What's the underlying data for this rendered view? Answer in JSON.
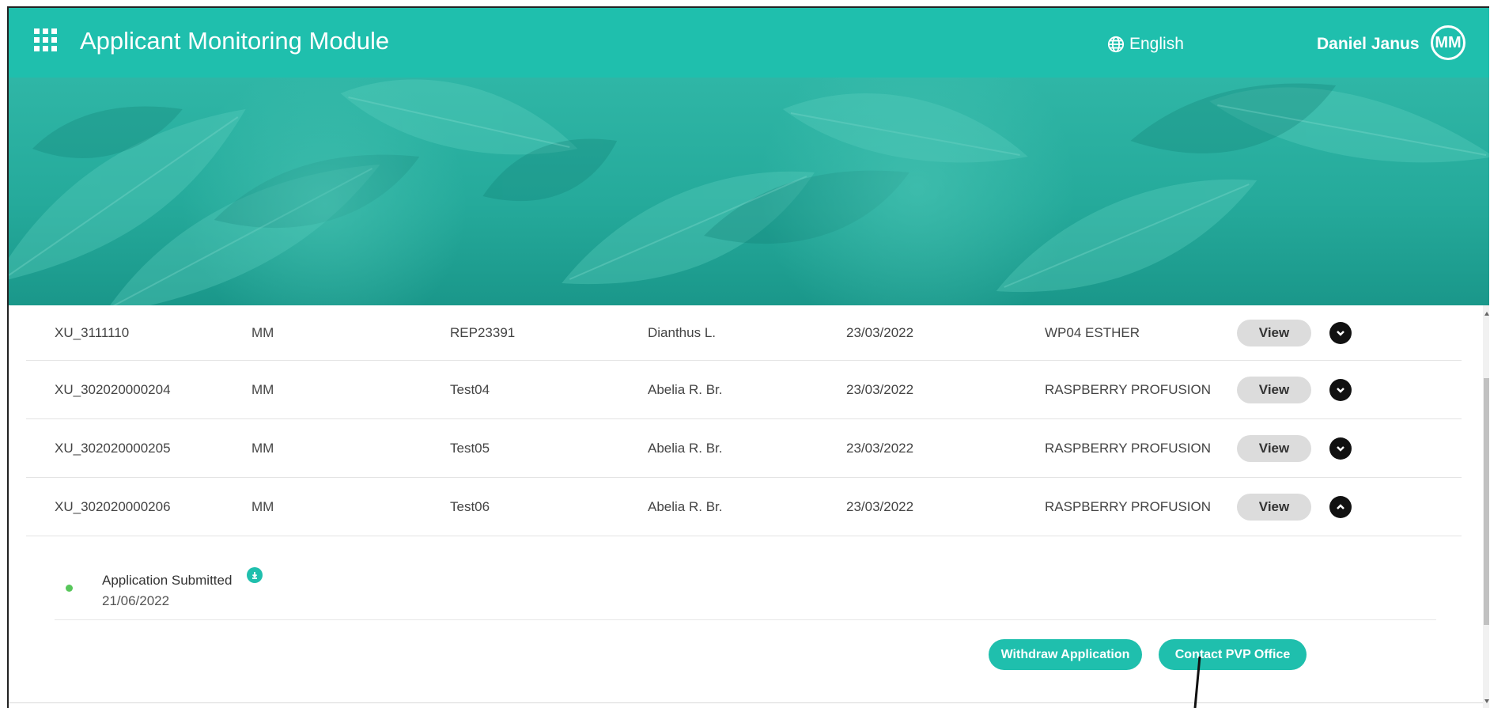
{
  "header": {
    "title": "Applicant Monitoring Module",
    "language": "English",
    "user_name": "Daniel Janus",
    "avatar_initials": "MM",
    "apps_icon": "apps-grid-icon",
    "language_icon": "globe-icon",
    "accent_color": "#1fbfad"
  },
  "applications": [
    {
      "id": "XU_3111110",
      "applicant": "MM",
      "reference": "REP23391",
      "species": "Dianthus L.",
      "date": "23/03/2022",
      "variety": "WP04 ESTHER",
      "view_label": "View",
      "expanded": false
    },
    {
      "id": "XU_302020000204",
      "applicant": "MM",
      "reference": "Test04",
      "species": "Abelia R. Br.",
      "date": "23/03/2022",
      "variety": "RASPBERRY PROFUSION",
      "view_label": "View",
      "expanded": false
    },
    {
      "id": "XU_302020000205",
      "applicant": "MM",
      "reference": "Test05",
      "species": "Abelia R. Br.",
      "date": "23/03/2022",
      "variety": "RASPBERRY PROFUSION",
      "view_label": "View",
      "expanded": false
    },
    {
      "id": "XU_302020000206",
      "applicant": "MM",
      "reference": "Test06",
      "species": "Abelia R. Br.",
      "date": "23/03/2022",
      "variety": "RASPBERRY PROFUSION",
      "view_label": "View",
      "expanded": true
    }
  ],
  "detail": {
    "status_label": "Application Submitted",
    "status_date": "21/06/2022",
    "status_color": "#57c65a",
    "withdraw_label": "Withdraw Application",
    "contact_label": "Contact PVP Office"
  }
}
